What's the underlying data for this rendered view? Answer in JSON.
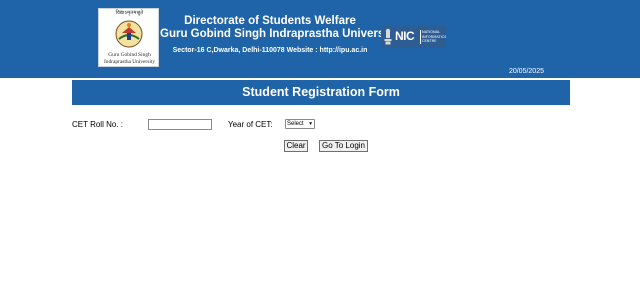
{
  "header": {
    "logo": {
      "arc_text": "विद्याऽमृतमश्नुते",
      "line1": "Guru Gobind Singh",
      "line2": "Indraprastha University"
    },
    "title_line1": "Directorate of Students Welfare",
    "title_line2": "Guru Gobind Singh Indraprastha University",
    "address_line": "Sector-16 C,Dwarka, Delhi-110078 Website : http://ipu.ac.in",
    "nic_logo": {
      "short": "NIC",
      "full_name": "NATIONAL INFORMATICS CENTRE"
    },
    "date": "20/05/2025"
  },
  "form": {
    "heading": "Student Registration Form",
    "cet_roll_label": "CET Roll No. :",
    "cet_roll_value": "",
    "year_label": "Year of CET:",
    "year_selected": "Select",
    "clear_label": "Clear",
    "login_label": "Go To Login"
  },
  "colors": {
    "header_bg": "#1f63a8",
    "banner_bg": "#1f63a8",
    "text_on_header": "#ffffff"
  },
  "icons": {
    "university_logo": "university-emblem",
    "nic_emblem": "national-emblem-icon",
    "select_arrow": "chevron-down-icon"
  }
}
